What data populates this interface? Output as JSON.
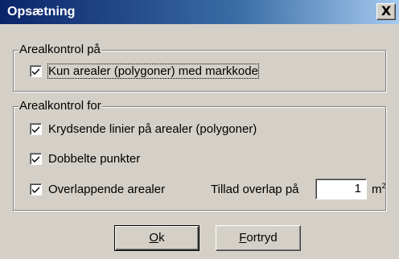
{
  "window": {
    "title": "Opsætning",
    "close_glyph": "X"
  },
  "group1": {
    "legend": "Arealkontrol på",
    "items": [
      {
        "label": "Kun arealer (polygoner) med markkode",
        "checked": true
      }
    ]
  },
  "group2": {
    "legend": "Arealkontrol for",
    "items": [
      {
        "label": "Krydsende linier på arealer (polygoner)",
        "checked": true
      },
      {
        "label": "Dobbelte punkter",
        "checked": true
      },
      {
        "label": "Overlappende arealer",
        "checked": true
      }
    ],
    "overlap_label": "Tillad overlap på",
    "overlap_value": "1",
    "unit_base": "m",
    "unit_exp": "2"
  },
  "buttons": {
    "ok_accel": "O",
    "ok_rest": "k",
    "cancel_accel": "F",
    "cancel_rest": "ortryd"
  },
  "icons": {
    "checkmark": "checkmark-icon",
    "close": "close-icon"
  }
}
